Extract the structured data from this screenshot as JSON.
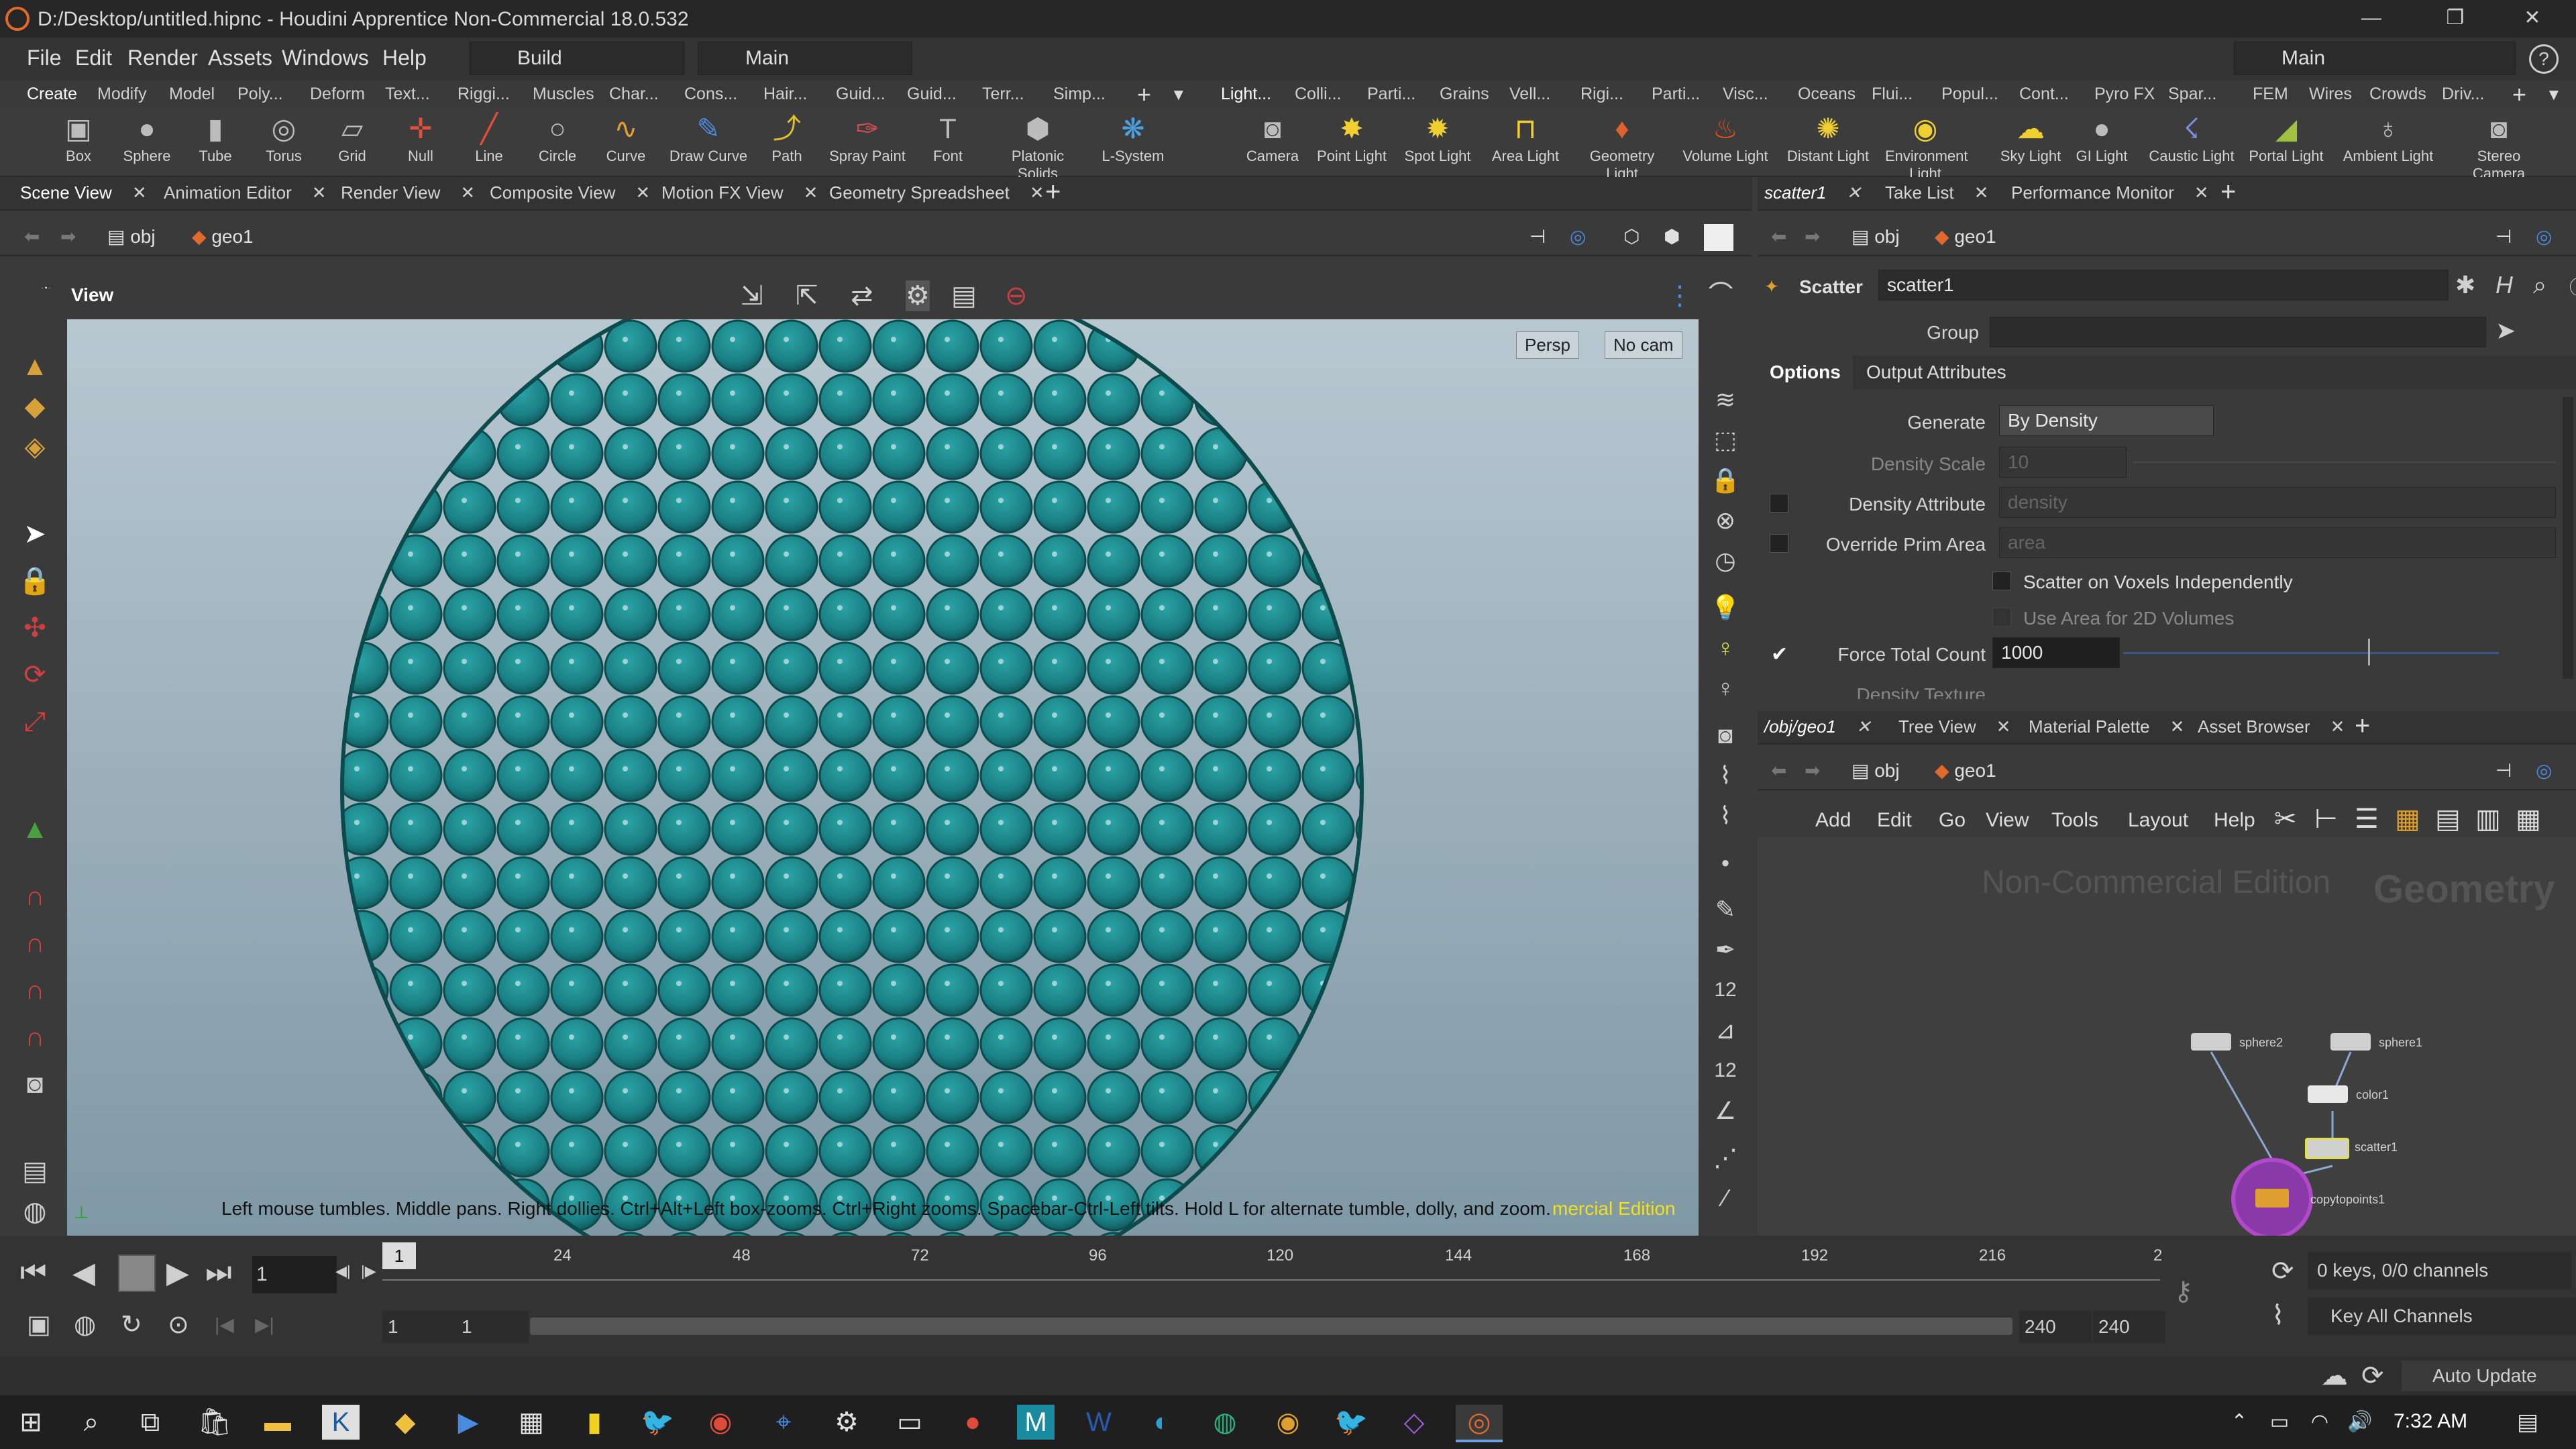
{
  "window": {
    "title": "D:/Desktop/untitled.hipnc - Houdini Apprentice Non-Commercial 18.0.532",
    "min": "—",
    "max": "❐",
    "close": "✕"
  },
  "menubar": {
    "items": [
      "File",
      "Edit",
      "Render",
      "Assets",
      "Windows",
      "Help"
    ],
    "desktop": "Build",
    "layout": "Main",
    "right_layout": "Main"
  },
  "shelf_tabs_left": [
    "Create",
    "Modify",
    "Model",
    "Poly...",
    "Deform",
    "Text...",
    "Riggi...",
    "Muscles",
    "Char...",
    "Cons...",
    "Hair...",
    "Guid...",
    "Guid...",
    "Terr...",
    "Simp..."
  ],
  "shelf_tabs_right": [
    "Light...",
    "Colli...",
    "Parti...",
    "Grains",
    "Vell...",
    "Rigi...",
    "Parti...",
    "Visc...",
    "Oceans",
    "Flui...",
    "Popul...",
    "Cont...",
    "Pyro FX",
    "Spar...",
    "FEM",
    "Wires",
    "Crowds",
    "Driv..."
  ],
  "tools_left": [
    "Box",
    "Sphere",
    "Tube",
    "Torus",
    "Grid",
    "Null",
    "Line",
    "Circle",
    "Curve",
    "Draw Curve",
    "Path",
    "Spray Paint",
    "Font",
    "Platonic Solids",
    "L-System"
  ],
  "tools_right": [
    "Camera",
    "Point Light",
    "Spot Light",
    "Area Light",
    "Geometry Light",
    "Volume Light",
    "Distant Light",
    "Environment Light",
    "Sky Light",
    "GI Light",
    "Caustic Light",
    "Portal Light",
    "Ambient Light",
    "Stereo Camera"
  ],
  "viewer_tabs": [
    "Scene View",
    "Animation Editor",
    "Render View",
    "Composite View",
    "Motion FX View",
    "Geometry Spreadsheet"
  ],
  "viewer_path": {
    "obj": "obj",
    "geo": "geo1"
  },
  "viewer": {
    "label": "View",
    "persp": "Persp",
    "cam": "No cam",
    "hint": "Left mouse tumbles. Middle pans. Right dollies. Ctrl+Alt+Left box-zooms. Ctrl+Right zooms. Spacebar-Ctrl-Left tilts. Hold L for alternate tumble, dolly, and zoom.",
    "watermark": "mercial Edition"
  },
  "param_tabs": [
    "scatter1",
    "Take List",
    "Performance Monitor"
  ],
  "params": {
    "node_type": "Scatter",
    "node_name": "scatter1",
    "group_label": "Group",
    "group_value": "",
    "tabs": [
      "Options",
      "Output Attributes"
    ],
    "generate_label": "Generate",
    "generate_value": "By Density",
    "density_scale_label": "Density Scale",
    "density_scale_value": "10",
    "density_attr_label": "Density Attribute",
    "density_attr_value": "density",
    "override_label": "Override Prim Area",
    "override_value": "area",
    "voxels_label": "Scatter on Voxels Independently",
    "area2d_label": "Use Area for 2D Volumes",
    "force_label": "Force Total Count",
    "force_value": "1000",
    "density_tex_label": "Density Texture"
  },
  "network_tabs": [
    "/obj/geo1",
    "Tree View",
    "Material Palette",
    "Asset Browser"
  ],
  "network_menu": [
    "Add",
    "Edit",
    "Go",
    "View",
    "Tools",
    "Layout",
    "Help"
  ],
  "network": {
    "watermark": "Non-Commercial Edition",
    "context": "Geometry",
    "nodes": [
      "sphere2",
      "sphere1",
      "color1",
      "scatter1",
      "copytopoints1"
    ]
  },
  "timeline": {
    "frame": "1",
    "ticks": [
      "24",
      "48",
      "72",
      "96",
      "120",
      "144",
      "168",
      "192",
      "216",
      "2"
    ],
    "start": "1",
    "start2": "1",
    "end": "240",
    "end2": "240",
    "keys": "0 keys, 0/0 channels",
    "keyall": "Key All Channels",
    "autoupdate": "Auto Update",
    "cur": "1"
  },
  "taskbar": {
    "time": "7:32 AM"
  }
}
